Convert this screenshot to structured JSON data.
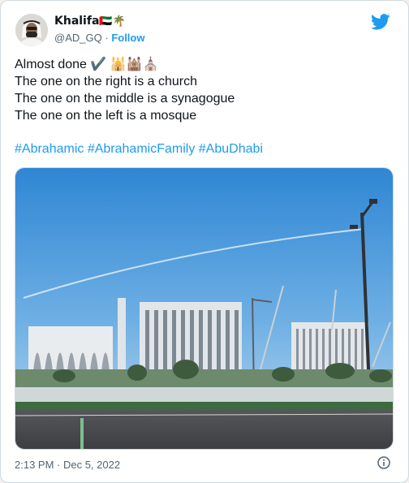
{
  "author": {
    "display_name": "Khalifa",
    "name_emoji": "🇦🇪🌴",
    "handle": "@AD_GQ",
    "separator": "·",
    "follow_label": "Follow"
  },
  "tweet": {
    "line1": "Almost done ✔️ 🕌🕍⛪",
    "line2": "The one on the right is a church",
    "line3": "The one on the middle is a synagogue",
    "line4": "The one on the left is a mosque",
    "hashtags": [
      "#Abrahamic",
      "#AbrahamicFamily",
      "#AbuDhabi"
    ]
  },
  "footer": {
    "timestamp": "2:13 PM · Dec 5, 2022"
  },
  "icons": {
    "brand": "twitter-bird-icon",
    "info": "info-icon",
    "brand_color": "#1d9bf0"
  },
  "media": {
    "description": "photo"
  }
}
